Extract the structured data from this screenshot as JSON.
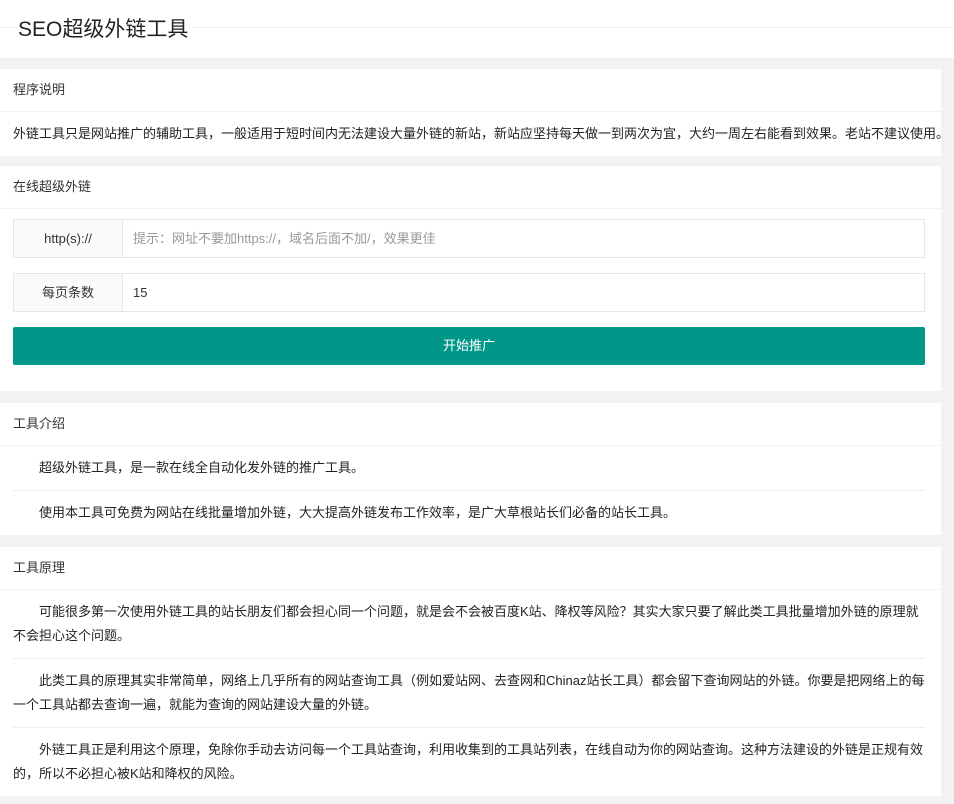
{
  "app": {
    "title": "SEO超级外链工具"
  },
  "intro_card": {
    "header": "程序说明",
    "text": "外链工具只是网站推广的辅助工具，一般适用于短时间内无法建设大量外链的新站，新站应坚持每天做一到两次为宜，大约一周左右能看到效果。老站不建议使用。"
  },
  "form_card": {
    "header": "在线超级外链",
    "url_label": "http(s)://",
    "url_value": "",
    "url_placeholder": "提示：网址不要加https://，域名后面不加/，效果更佳",
    "count_label": "每页条数",
    "count_value": "15",
    "submit_label": "开始推广"
  },
  "tool_intro": {
    "header": "工具介绍",
    "paragraphs": [
      "超级外链工具，是一款在线全自动化发外链的推广工具。",
      "使用本工具可免费为网站在线批量增加外链，大大提高外链发布工作效率，是广大草根站长们必备的站长工具。"
    ]
  },
  "tool_principle": {
    "header": "工具原理",
    "paragraphs": [
      "可能很多第一次使用外链工具的站长朋友们都会担心同一个问题，就是会不会被百度K站、降权等风险？其实大家只要了解此类工具批量增加外链的原理就不会担心这个问题。",
      "此类工具的原理其实非常简单，网络上几乎所有的网站查询工具（例如爱站网、去查网和Chinaz站长工具）都会留下查询网站的外链。你要是把网络上的每一个工具站都去查询一遍，就能为查询的网站建设大量的外链。",
      "外链工具正是利用这个原理，免除你手动去访问每一个工具站查询，利用收集到的工具站列表，在线自动为你的网站查询。这种方法建设的外链是正规有效的，所以不必担心被K站和降权的风险。"
    ]
  },
  "colors": {
    "accent": "#009688",
    "background": "#f2f2f2"
  }
}
